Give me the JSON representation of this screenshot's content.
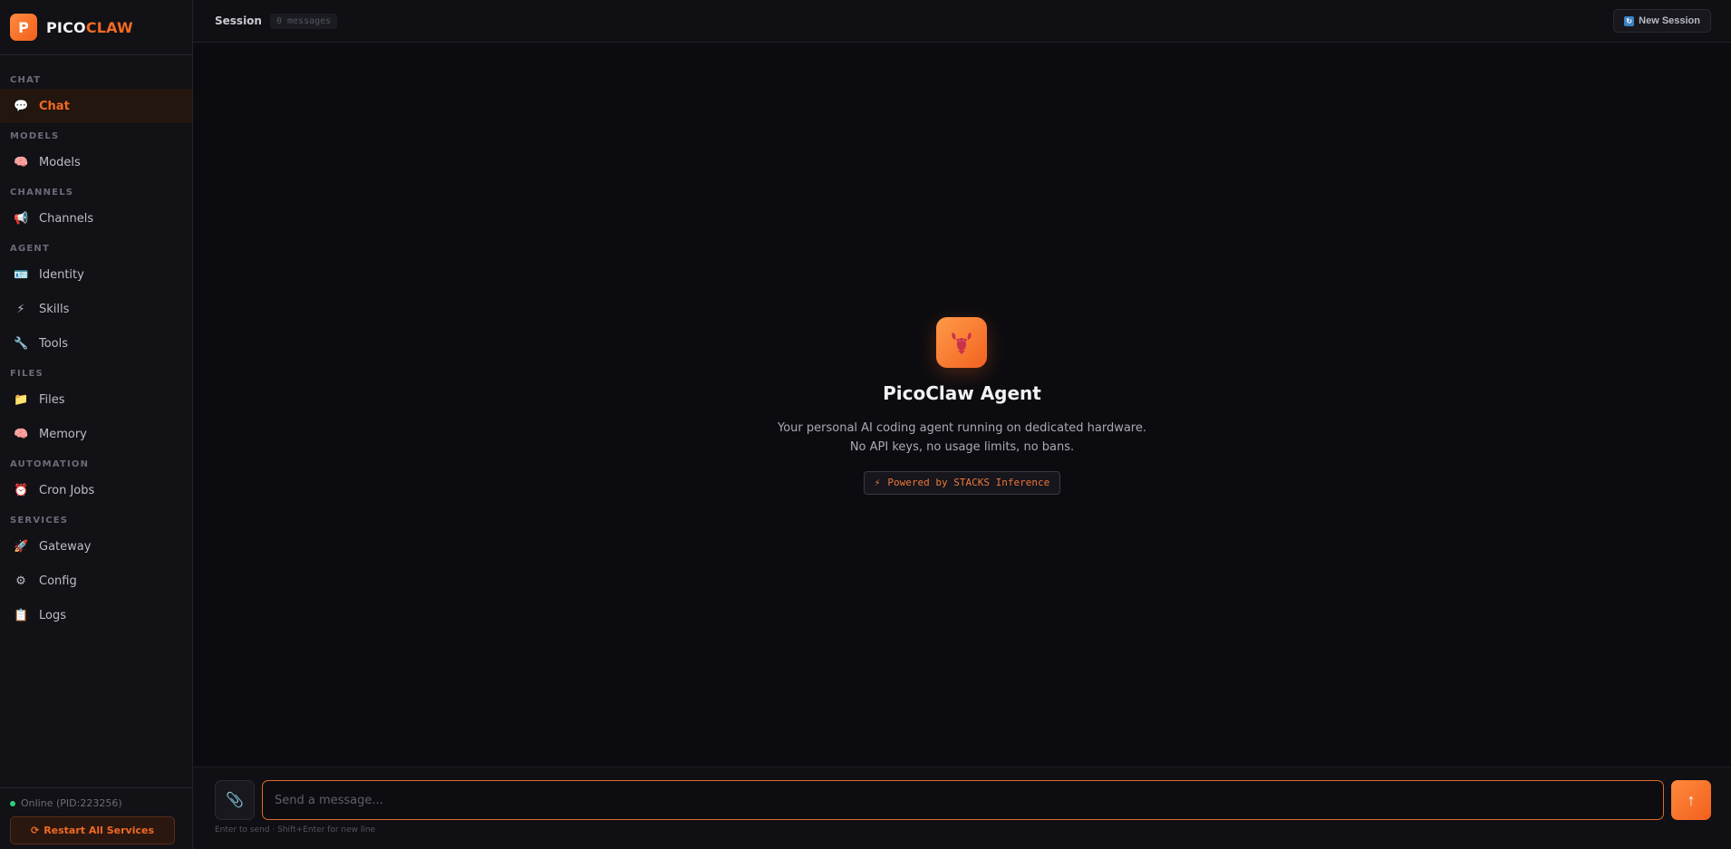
{
  "brand": {
    "logo_letter": "P",
    "name_part1": "PICO",
    "name_part2": "CLAW",
    "accent": "#f26a22"
  },
  "sidebar": {
    "sections": [
      {
        "label": "CHAT",
        "items": [
          {
            "label": "Chat",
            "icon": "speech-bubble-icon",
            "glyph": "💬",
            "active": true
          }
        ]
      },
      {
        "label": "MODELS",
        "items": [
          {
            "label": "Models",
            "icon": "brain-icon",
            "glyph": "🧠"
          }
        ]
      },
      {
        "label": "CHANNELS",
        "items": [
          {
            "label": "Channels",
            "icon": "megaphone-icon",
            "glyph": "📢"
          }
        ]
      },
      {
        "label": "AGENT",
        "items": [
          {
            "label": "Identity",
            "icon": "id-card-icon",
            "glyph": "🪪"
          },
          {
            "label": "Skills",
            "icon": "lightning-icon",
            "glyph": "⚡"
          },
          {
            "label": "Tools",
            "icon": "wrench-icon",
            "glyph": "🔧"
          }
        ]
      },
      {
        "label": "FILES",
        "items": [
          {
            "label": "Files",
            "icon": "folder-icon",
            "glyph": "📁"
          },
          {
            "label": "Memory",
            "icon": "brain-icon",
            "glyph": "🧠"
          }
        ]
      },
      {
        "label": "AUTOMATION",
        "items": [
          {
            "label": "Cron Jobs",
            "icon": "alarm-clock-icon",
            "glyph": "⏰"
          }
        ]
      },
      {
        "label": "SERVICES",
        "items": [
          {
            "label": "Gateway",
            "icon": "rocket-icon",
            "glyph": "🚀"
          },
          {
            "label": "Config",
            "icon": "gear-icon",
            "glyph": "⚙"
          },
          {
            "label": "Logs",
            "icon": "clipboard-icon",
            "glyph": "📋"
          }
        ]
      }
    ],
    "status": "Online (PID:223256)",
    "restart_label": "Restart All Services"
  },
  "topbar": {
    "session_label": "Session",
    "message_count": "0 messages",
    "new_session_label": "New Session"
  },
  "hero": {
    "title": "PicoClaw Agent",
    "desc_line1": "Your personal AI coding agent running on dedicated hardware.",
    "desc_line2": "No API keys, no usage limits, no bans.",
    "powered_by": "Powered by STACKS Inference"
  },
  "composer": {
    "placeholder": "Send a message...",
    "hint": "Enter to send · Shift+Enter for new line"
  }
}
